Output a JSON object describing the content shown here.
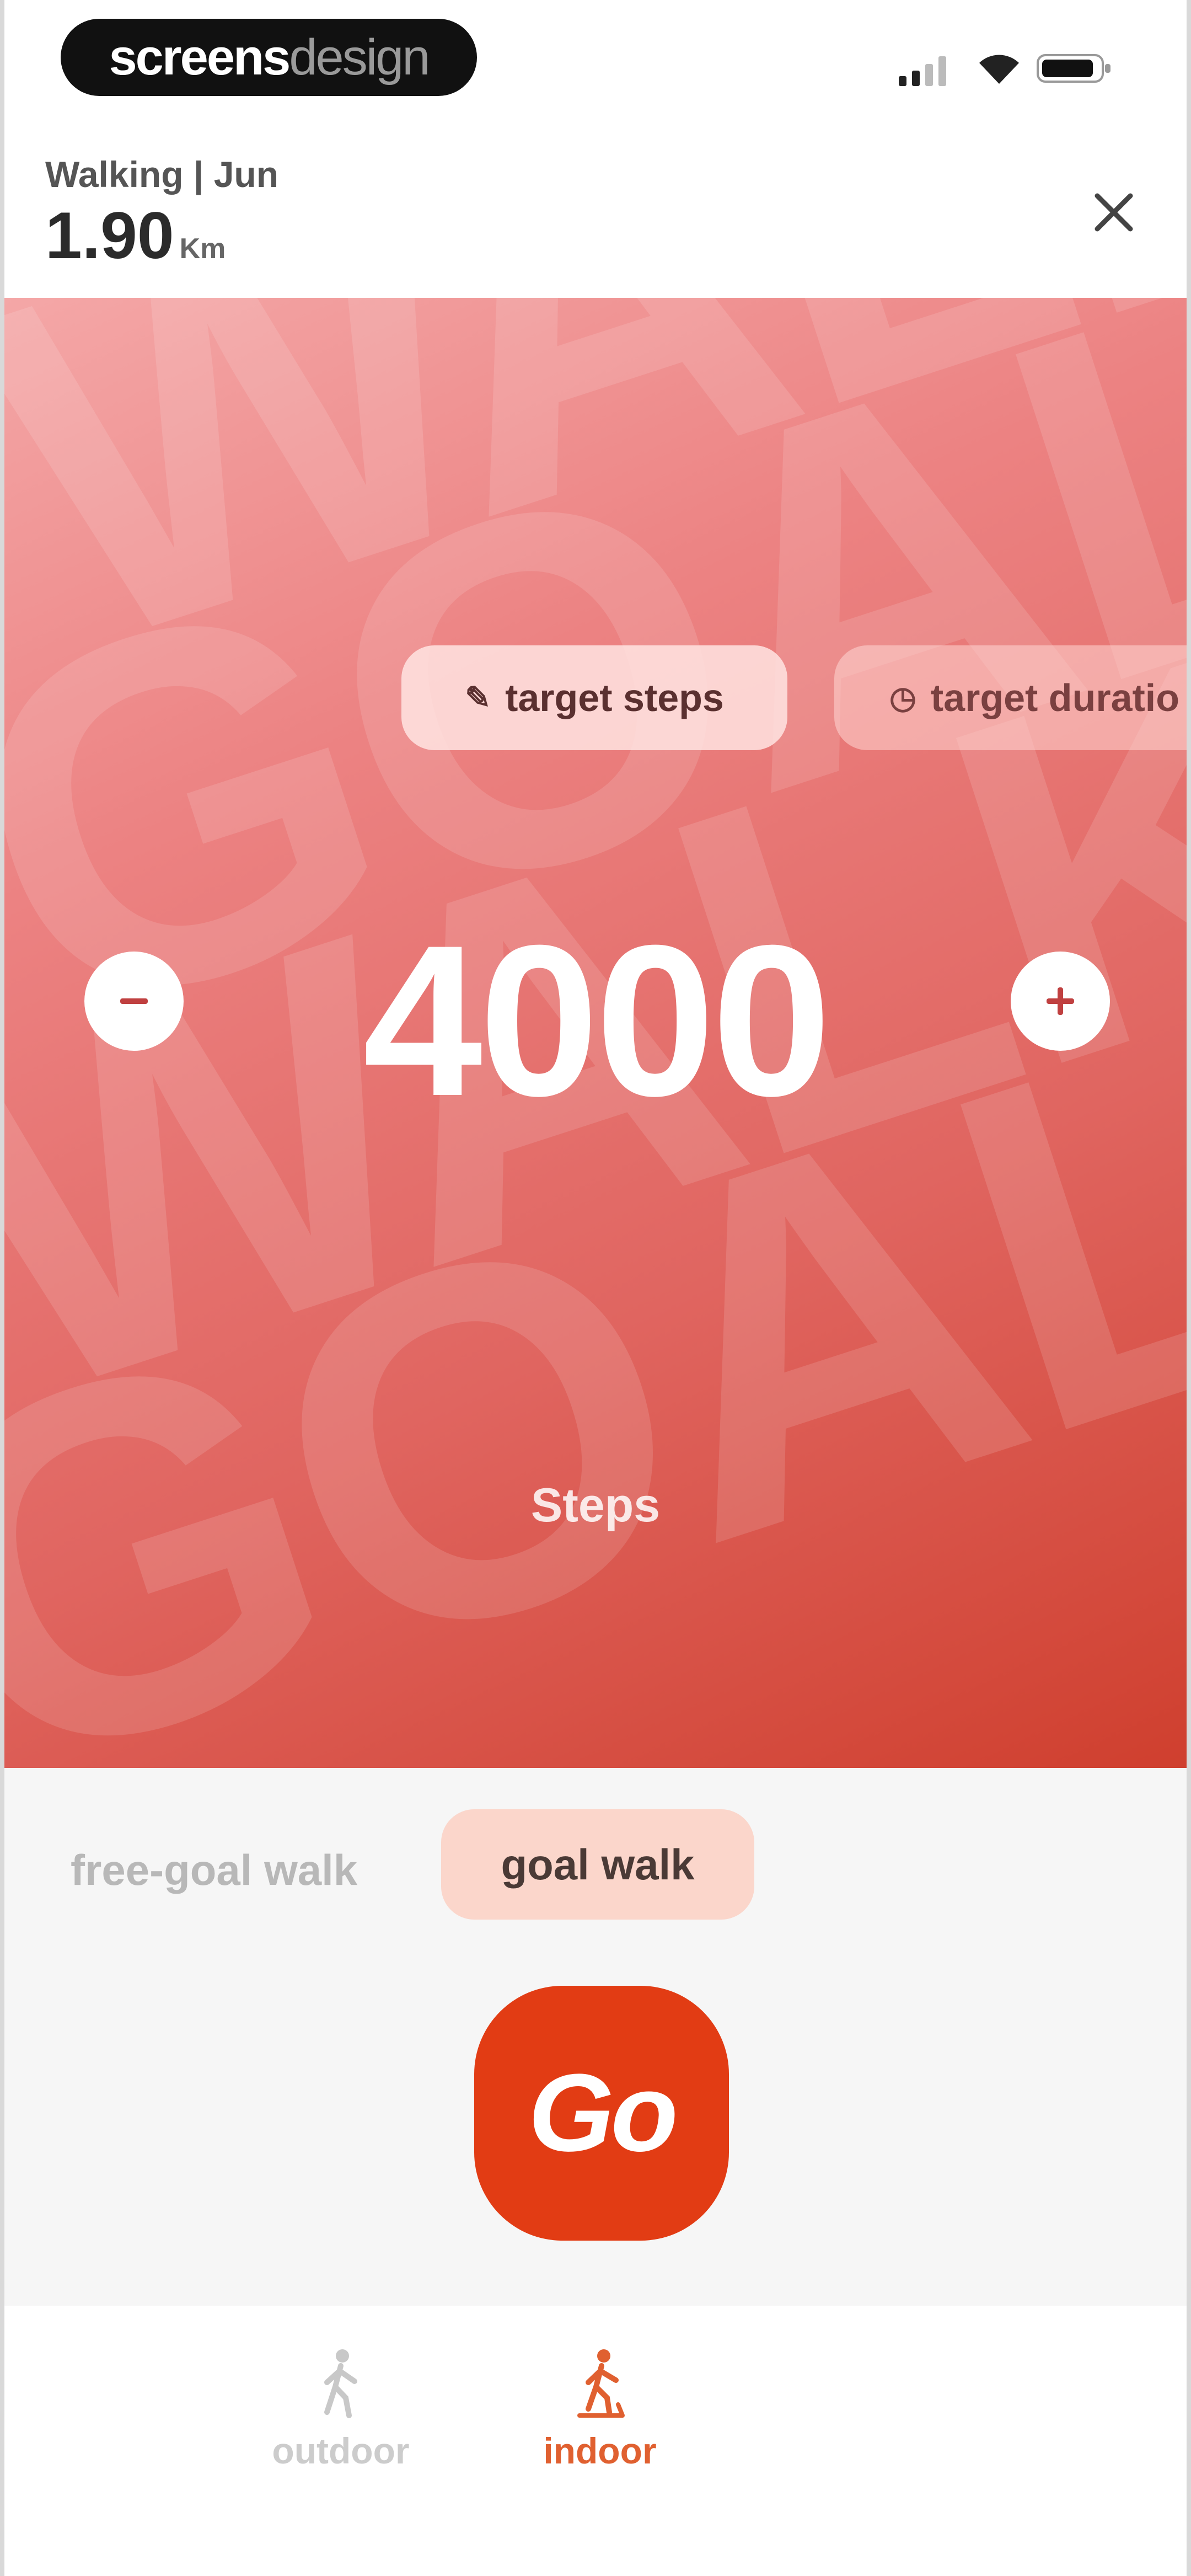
{
  "status_bar": {
    "logo_primary": "screens",
    "logo_secondary": "design",
    "icons": [
      "signal-icon",
      "wifi-icon",
      "battery-icon"
    ]
  },
  "header": {
    "subtitle": "Walking | Jun",
    "distance_value": "1.90",
    "distance_unit": "Km",
    "close_icon": "close-icon"
  },
  "hero": {
    "background_words": [
      "WALK",
      "GOAL",
      "WALK",
      "GOAL"
    ],
    "chips": [
      {
        "label": "target steps",
        "icon": "pencil-icon",
        "selected": true
      },
      {
        "label": "target duratio",
        "icon": "clock-icon",
        "selected": false
      }
    ],
    "goal_value": "4000",
    "goal_unit": "Steps",
    "minus_symbol": "−",
    "plus_symbol": "+"
  },
  "modes": {
    "free_label": "free-goal walk",
    "goal_label": "goal walk",
    "selected": "goal walk"
  },
  "go_button": {
    "label": "Go"
  },
  "tabs": [
    {
      "label": "outdoor",
      "icon": "walker-icon",
      "active": false
    },
    {
      "label": "indoor",
      "icon": "treadmill-walker-icon",
      "active": true
    }
  ],
  "colors": {
    "accent": "#e23c14",
    "hero_start": "#f4a7a7",
    "hero_end": "#cf3f2e",
    "selected_chip": "#fbd6cb",
    "active_tab": "#e06030",
    "inactive_tab": "#cccccc"
  }
}
